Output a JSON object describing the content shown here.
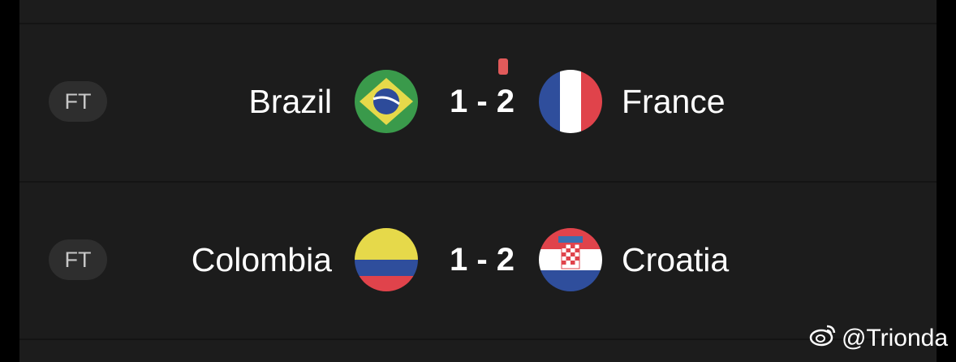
{
  "matches": [
    {
      "status": "FT",
      "home_team": "Brazil",
      "home_flag": "brazil-flag",
      "score": "1 - 2",
      "away_team": "France",
      "away_flag": "france-flag",
      "red_card": true
    },
    {
      "status": "FT",
      "home_team": "Colombia",
      "home_flag": "colombia-flag",
      "score": "1 - 2",
      "away_team": "Croatia",
      "away_flag": "croatia-flag",
      "red_card": false
    }
  ],
  "watermark": {
    "icon": "weibo-icon",
    "text": "@Trionda"
  },
  "colors": {
    "background": "#1c1c1c",
    "status_pill": "#2e2e2e",
    "red_card": "#e15a5a"
  }
}
